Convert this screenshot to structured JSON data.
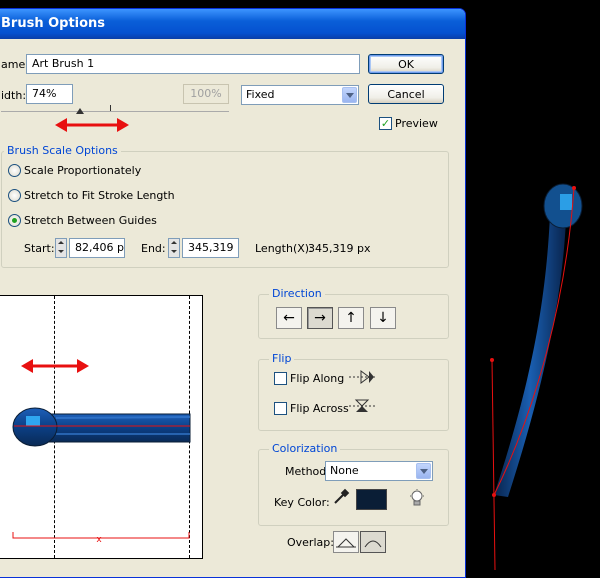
{
  "dialog": {
    "title": "Brush Options",
    "name_label": "ame:",
    "name_value": "Art Brush 1",
    "width_label": "idth:",
    "width_value": "74%",
    "width_max": "100%",
    "width_mode": "Fixed",
    "ok_label": "OK",
    "cancel_label": "Cancel",
    "preview_label": "Preview",
    "preview_checked": true
  },
  "scale": {
    "title": "Brush Scale Options",
    "options": [
      {
        "label": "Scale Proportionately",
        "selected": false
      },
      {
        "label": "Stretch to Fit Stroke Length",
        "selected": false
      },
      {
        "label": "Stretch Between Guides",
        "selected": true
      }
    ],
    "start_label": "Start:",
    "start_value": "82,406 p",
    "end_label": "End:",
    "end_value": "345,319",
    "length_label": "Length(X):",
    "length_value": "345,319 px"
  },
  "direction": {
    "title": "Direction",
    "buttons": [
      "←",
      "→",
      "↑",
      "↓"
    ],
    "active_index": 1
  },
  "flip": {
    "title": "Flip",
    "along_label": "Flip Along",
    "across_label": "Flip Across"
  },
  "colorization": {
    "title": "Colorization",
    "method_label": "Method:",
    "method_value": "None",
    "key_color_label": "Key Color:",
    "key_color": "#0a1e36"
  },
  "overlap": {
    "label": "Overlap:"
  },
  "colors": {
    "accent_blue": "#0551d0",
    "annotation_red": "#e81010",
    "brush_blue": "#1e6fd0"
  }
}
